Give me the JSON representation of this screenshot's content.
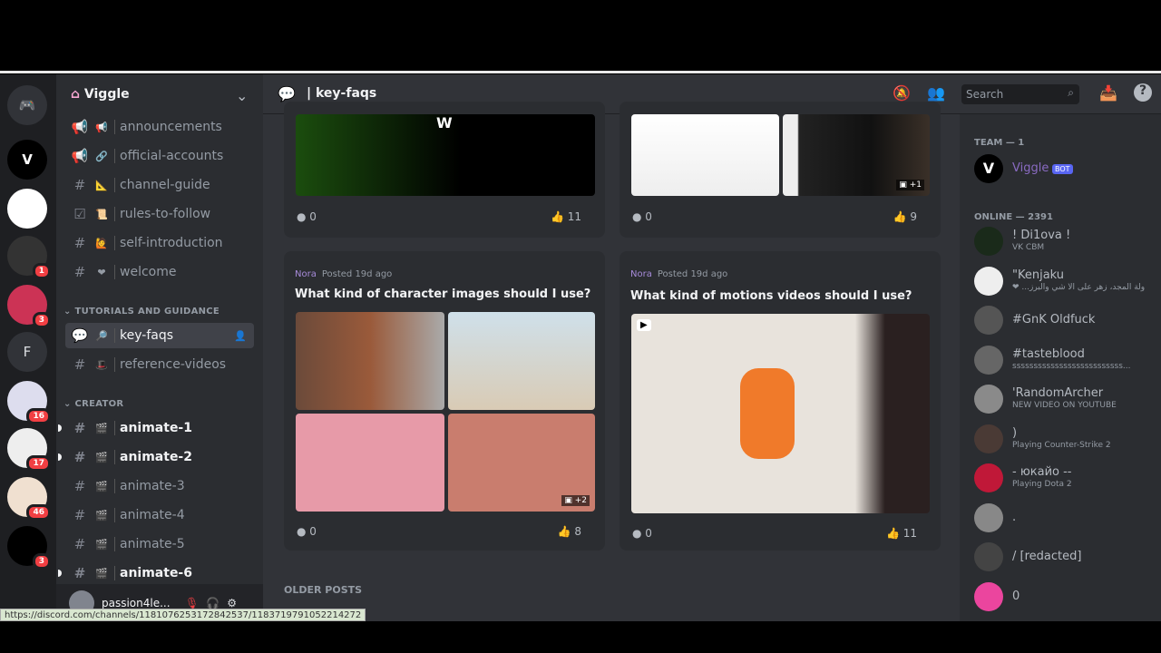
{
  "server": {
    "name": "Viggle"
  },
  "rail": [
    {
      "label": "",
      "badge": ""
    },
    {
      "label": "",
      "badge": ""
    },
    {
      "label": "",
      "badge": ""
    },
    {
      "label": "",
      "badge": "1"
    },
    {
      "label": "",
      "badge": "3"
    },
    {
      "label": "F",
      "badge": ""
    },
    {
      "label": "",
      "badge": "16"
    },
    {
      "label": "",
      "badge": "17"
    },
    {
      "label": "",
      "badge": "46"
    },
    {
      "label": "",
      "badge": "3"
    }
  ],
  "channels": [
    {
      "name": "announcements",
      "icon": "megaphone",
      "emoji": "📢"
    },
    {
      "name": "official-accounts",
      "icon": "megaphone",
      "emoji": "🔗"
    },
    {
      "name": "channel-guide",
      "icon": "#",
      "emoji": "📐"
    },
    {
      "name": "rules-to-follow",
      "icon": "rules",
      "emoji": "📜"
    },
    {
      "name": "self-introduction",
      "icon": "#",
      "emoji": "🙋"
    },
    {
      "name": "welcome",
      "icon": "#",
      "emoji": "❤"
    }
  ],
  "categories": {
    "tutorials": "TUTORIALS AND GUIDANCE",
    "creator": "CREATOR"
  },
  "tutorial_channels": [
    {
      "name": "key-faqs",
      "emoji": "🔎"
    },
    {
      "name": "reference-videos",
      "emoji": "🎩"
    }
  ],
  "creator_channels": [
    {
      "name": "animate-1",
      "unread": true
    },
    {
      "name": "animate-2",
      "unread": true
    },
    {
      "name": "animate-3",
      "unread": false
    },
    {
      "name": "animate-4",
      "unread": false
    },
    {
      "name": "animate-5",
      "unread": false
    },
    {
      "name": "animate-6",
      "unread": true
    }
  ],
  "user": {
    "name": "passion4le..."
  },
  "header": {
    "channel": "| key-faqs",
    "search_placeholder": "Search"
  },
  "posts": [
    {
      "comments": "0",
      "likes": "11"
    },
    {
      "comments": "0",
      "likes": "9",
      "more": "+1"
    },
    {
      "author": "Nora",
      "posted": "Posted 19d ago",
      "title": "What kind of character images should I use?",
      "comments": "0",
      "likes": "8",
      "more": "+2"
    },
    {
      "author": "Nora",
      "posted": "Posted 19d ago",
      "title": "What kind of motions videos should I use?",
      "comments": "0",
      "likes": "11"
    }
  ],
  "older_posts": "OLDER POSTS",
  "members": {
    "team_header": "TEAM — 1",
    "team": [
      {
        "name": "Viggle",
        "tag": "BOT"
      }
    ],
    "online_header": "ONLINE — 2391",
    "online": [
      {
        "name": "! Di1ova !",
        "status": "VK CBM",
        "color": "#1a2a1a"
      },
      {
        "name": "\"Kenjaku",
        "status": "❤ ...ولة المجد، زهر على الأ شي والبرز",
        "color": "#eee"
      },
      {
        "name": "#GnK Oldfuck",
        "status": "",
        "color": "#555"
      },
      {
        "name": "#tasteblood",
        "status": "ssssssssssssssssssssssssss...",
        "color": "#666"
      },
      {
        "name": "'RandomArcher",
        "status": "NEW VIDEO ON YOUTUBE",
        "color": "#8a8a8a"
      },
      {
        "name": ")",
        "status": "Playing Counter-Strike 2",
        "color": "#4a3a35"
      },
      {
        "name": "- юкайо --",
        "status": "Playing Dota 2",
        "color": "#c01838"
      },
      {
        "name": ".",
        "status": "",
        "color": "#888"
      },
      {
        "name": "/ [redacted]",
        "status": "",
        "color": "#444"
      },
      {
        "name": "0",
        "status": "",
        "color": "#eb459e"
      }
    ]
  },
  "status_url": "https://discord.com/channels/1181076253172842537/1183719791052214272",
  "colors": {
    "accent": "#5865f2",
    "bot_name": "#a78bda",
    "unread_badge": "#f23f43"
  }
}
